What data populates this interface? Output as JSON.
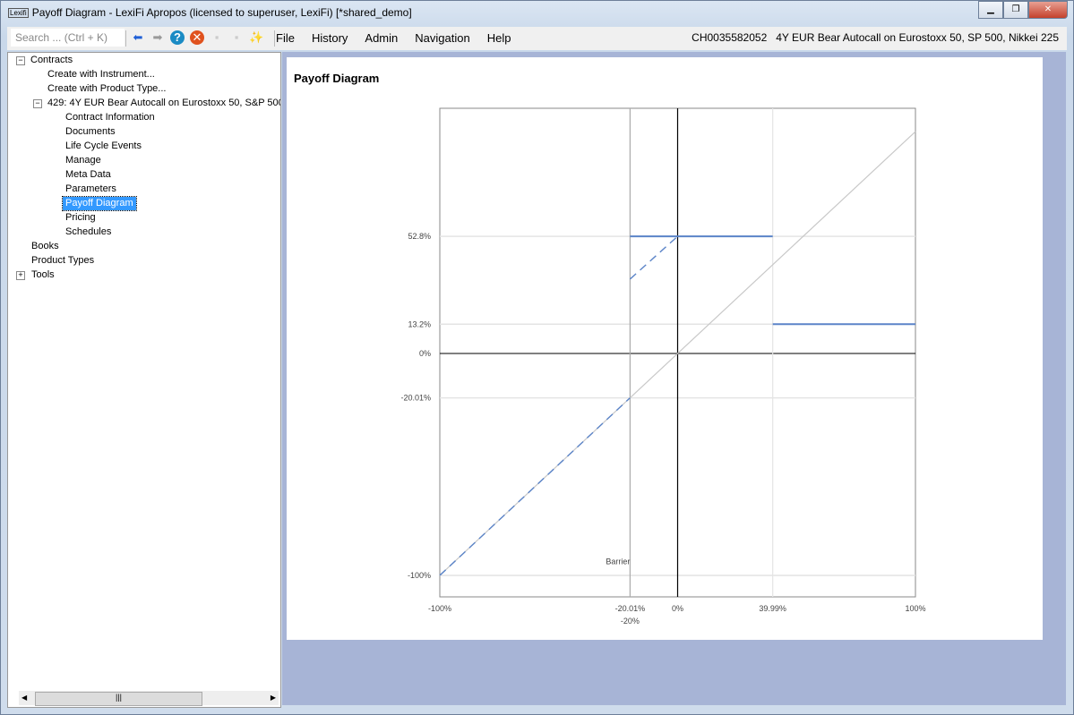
{
  "window": {
    "title": "Payoff Diagram - LexiFi Apropos  (licensed to superuser, LexiFi) [*shared_demo]",
    "logo": "Lexifi"
  },
  "toolbar": {
    "search_placeholder": "Search ... (Ctrl + K)",
    "menu": [
      "File",
      "History",
      "Admin",
      "Navigation",
      "Help"
    ],
    "contract_id": "CH0035582052",
    "contract_name": "4Y EUR Bear Autocall on Eurostoxx 50, SP 500, Nikkei 225"
  },
  "tree": {
    "contracts": "Contracts",
    "create_instrument": "Create with Instrument...",
    "create_product": "Create with Product Type...",
    "contract": "429: 4Y EUR Bear Autocall on Eurostoxx 50, S&P 500,",
    "children": [
      "Contract Information",
      "Documents",
      "Life Cycle Events",
      "Manage",
      "Meta Data",
      "Parameters",
      "Payoff Diagram",
      "Pricing",
      "Schedules"
    ],
    "selected": "Payoff Diagram",
    "books": "Books",
    "product_types": "Product Types",
    "tools": "Tools"
  },
  "panel": {
    "title": "Payoff Diagram"
  },
  "chart_data": {
    "type": "line",
    "title": "Payoff Diagram",
    "xlim": [
      -100,
      100
    ],
    "ylim": [
      -109.7,
      110.5
    ],
    "x_ticks": [
      {
        "v": -100,
        "label": "-100%"
      },
      {
        "v": -20.01,
        "label": "-20.01%"
      },
      {
        "v": 0,
        "label": "0%"
      },
      {
        "v": 39.99,
        "label": "39.99%"
      },
      {
        "v": 100,
        "label": "100%"
      }
    ],
    "x_extra_label": {
      "v": -20,
      "label": "-20%"
    },
    "y_ticks": [
      {
        "v": 52.8,
        "label": "52.8%"
      },
      {
        "v": 13.2,
        "label": "13.2%"
      },
      {
        "v": 0,
        "label": "0%"
      },
      {
        "v": -20.01,
        "label": "-20.01%"
      },
      {
        "v": -100,
        "label": "-100%"
      }
    ],
    "annotation": {
      "text": "Barrier",
      "x": -20.01
    },
    "reference_line": {
      "points": [
        [
          -100,
          -100
        ],
        [
          100,
          100
        ]
      ],
      "color": "#c8c8c8"
    },
    "series": [
      {
        "style": "dashed",
        "color": "#5b84c8",
        "points": [
          [
            -100,
            -100
          ],
          [
            -20.01,
            -20.01
          ]
        ]
      },
      {
        "style": "dashed",
        "color": "#5b84c8",
        "points": [
          [
            -20.01,
            33.5
          ],
          [
            0,
            52.8
          ]
        ]
      },
      {
        "style": "solid",
        "color": "#5b84c8",
        "points": [
          [
            -20.01,
            52.8
          ],
          [
            39.99,
            52.8
          ]
        ]
      },
      {
        "style": "solid",
        "color": "#5b84c8",
        "points": [
          [
            39.99,
            13.2
          ],
          [
            100,
            13.2
          ]
        ]
      }
    ]
  }
}
